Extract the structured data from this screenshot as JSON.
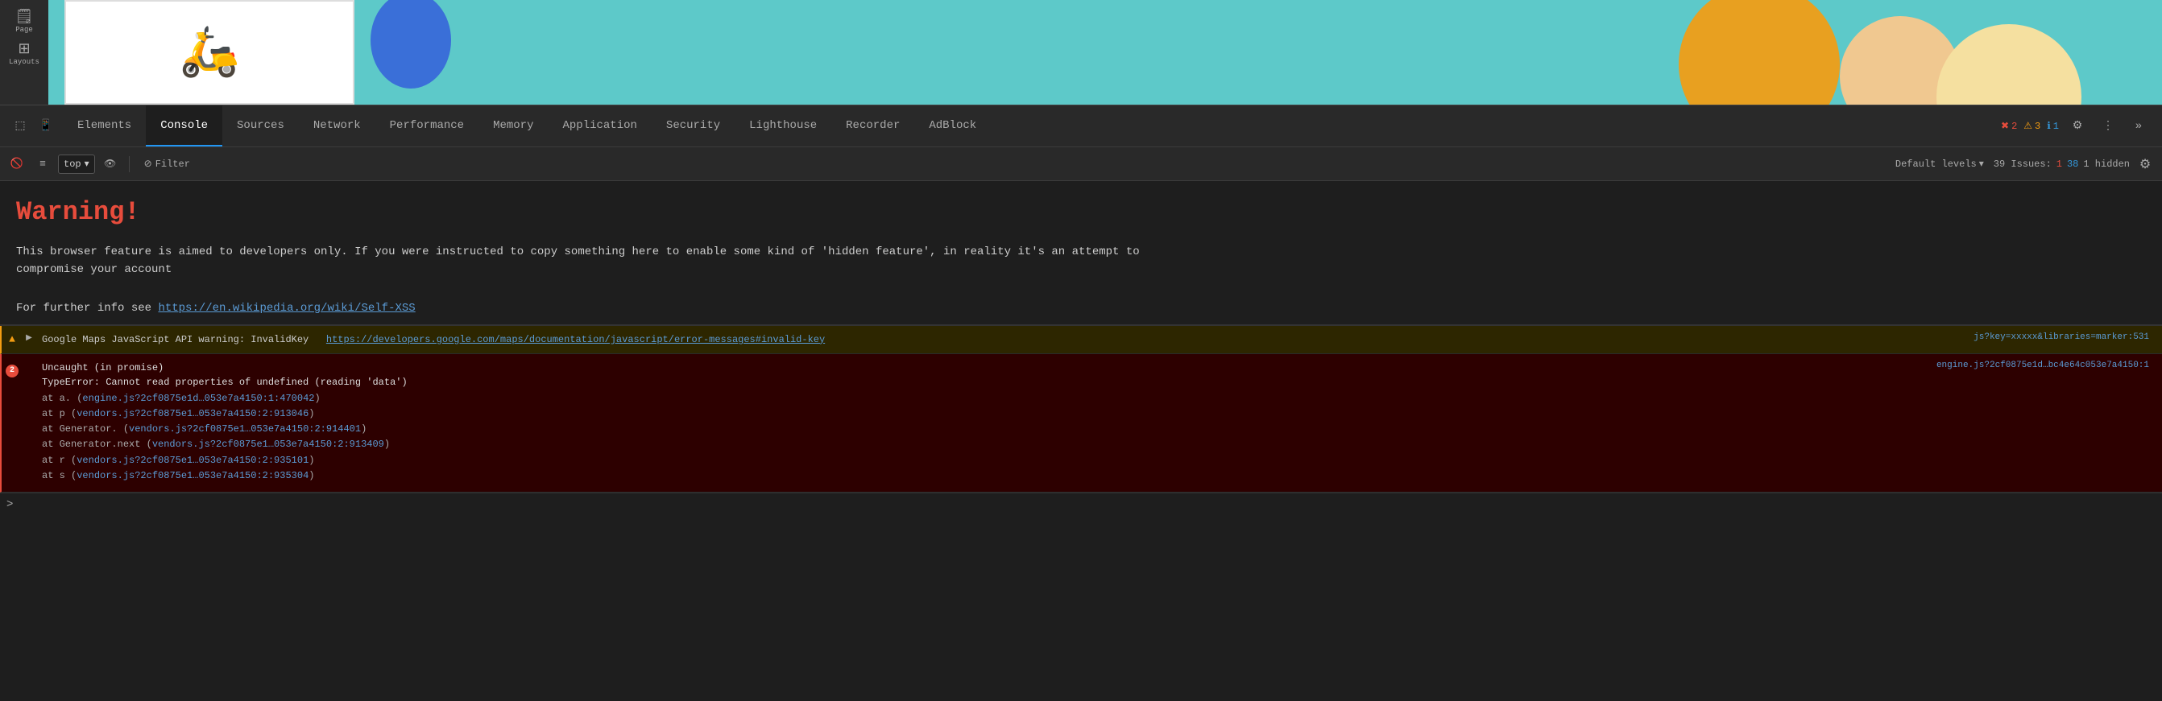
{
  "page": {
    "left_panel": {
      "items": [
        "Page",
        "Layouts"
      ]
    }
  },
  "devtools": {
    "tabs": [
      {
        "id": "elements",
        "label": "Elements",
        "active": false
      },
      {
        "id": "console",
        "label": "Console",
        "active": true
      },
      {
        "id": "sources",
        "label": "Sources",
        "active": false
      },
      {
        "id": "network",
        "label": "Network",
        "active": false
      },
      {
        "id": "performance",
        "label": "Performance",
        "active": false
      },
      {
        "id": "memory",
        "label": "Memory",
        "active": false
      },
      {
        "id": "application",
        "label": "Application",
        "active": false
      },
      {
        "id": "security",
        "label": "Security",
        "active": false
      },
      {
        "id": "lighthouse",
        "label": "Lighthouse",
        "active": false
      },
      {
        "id": "recorder",
        "label": "Recorder",
        "active": false
      },
      {
        "id": "adblock",
        "label": "AdBlock",
        "active": false
      }
    ],
    "badges": {
      "errors": "2",
      "warnings": "3",
      "info": "1"
    },
    "toolbar": {
      "context_selector": "top",
      "filter_label": "Filter",
      "default_levels_label": "Default levels",
      "issues_label": "39 Issues:",
      "issues_error": "1",
      "issues_warning": "38",
      "hidden_label": "1 hidden"
    },
    "console": {
      "warning_heading": "Warning!",
      "warning_text": "This browser feature is aimed to developers only. If you were instructed to copy something here to enable some kind of 'hidden feature', in reality it's an attempt to\ncompromise your account",
      "info_prefix": "For further info see ",
      "info_link_text": "https://en.wikipedia.org/wiki/Self-XSS",
      "info_link_url": "https://en.wikipedia.org/wiki/Self-XSS",
      "log_entries": [
        {
          "type": "warning",
          "icon": "▲",
          "has_arrow": true,
          "text": "Google Maps JavaScript API warning: InvalidKey",
          "link_text": "https://developers.google.com/maps/documentation/javascript/error-messages#invalid-key",
          "link_url": "https://developers.google.com/maps/documentation/javascript/error-messages#invalid-key",
          "source": "js?key=xxxxx&libraries=marker:531"
        },
        {
          "type": "error",
          "icon": "●",
          "has_arrow": false,
          "badge": "2",
          "main_text": "Uncaught (in promise)",
          "error_text": "TypeError: Cannot read properties of undefined (reading 'data')",
          "stack": [
            "    at a.<anonymous> (engine.js?2cf0875e1d…053e7a4150:1:470042)",
            "    at p (vendors.js?2cf0875e1…053e7a4150:2:913046)",
            "    at Generator.<anonymous> (vendors.js?2cf0875e1…053e7a4150:2:914401)",
            "    at Generator.next (vendors.js?2cf0875e1…053e7a4150:2:913409)",
            "    at r (vendors.js?2cf0875e1…053e7a4150:2:935101)",
            "    at s (vendors.js?2cf0875e1…053e7a4150:2:935304)"
          ],
          "source": "engine.js?2cf0875e1d…bc4e64c053e7a4150:1"
        }
      ]
    }
  }
}
